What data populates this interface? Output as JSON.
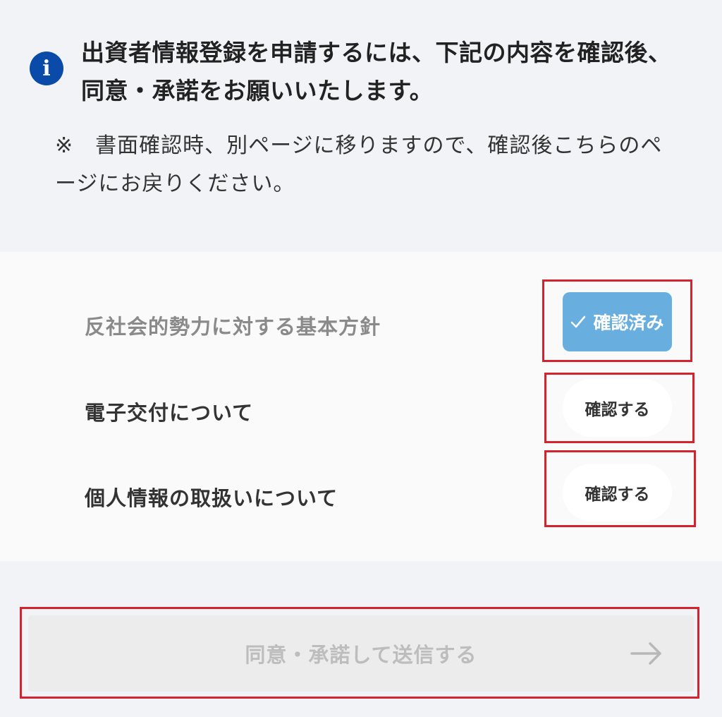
{
  "header": {
    "icon": "info-icon",
    "icon_glyph": "i",
    "title": "出資者情報登録を申請するには、下記の内容を確認後、同意・承諾をお願いいたします。",
    "note": "※　書面確認時、別ページに移りますので、確認後こちらのページにお戻りください。"
  },
  "documents": [
    {
      "label": "反社会的勢力に対する基本方針",
      "status": "confirmed",
      "button_label": "確認済み"
    },
    {
      "label": "電子交付について",
      "status": "unconfirmed",
      "button_label": "確認する"
    },
    {
      "label": "個人情報の取扱いについて",
      "status": "unconfirmed",
      "button_label": "確認する"
    }
  ],
  "submit": {
    "label": "同意・承諾して送信する",
    "icon": "arrow-right-icon",
    "enabled": false
  },
  "colors": {
    "info_icon": "#0a4aa8",
    "confirmed_button": "#68afdf",
    "highlight_outline": "#d2232e",
    "disabled_text": "#bdbdbd"
  }
}
